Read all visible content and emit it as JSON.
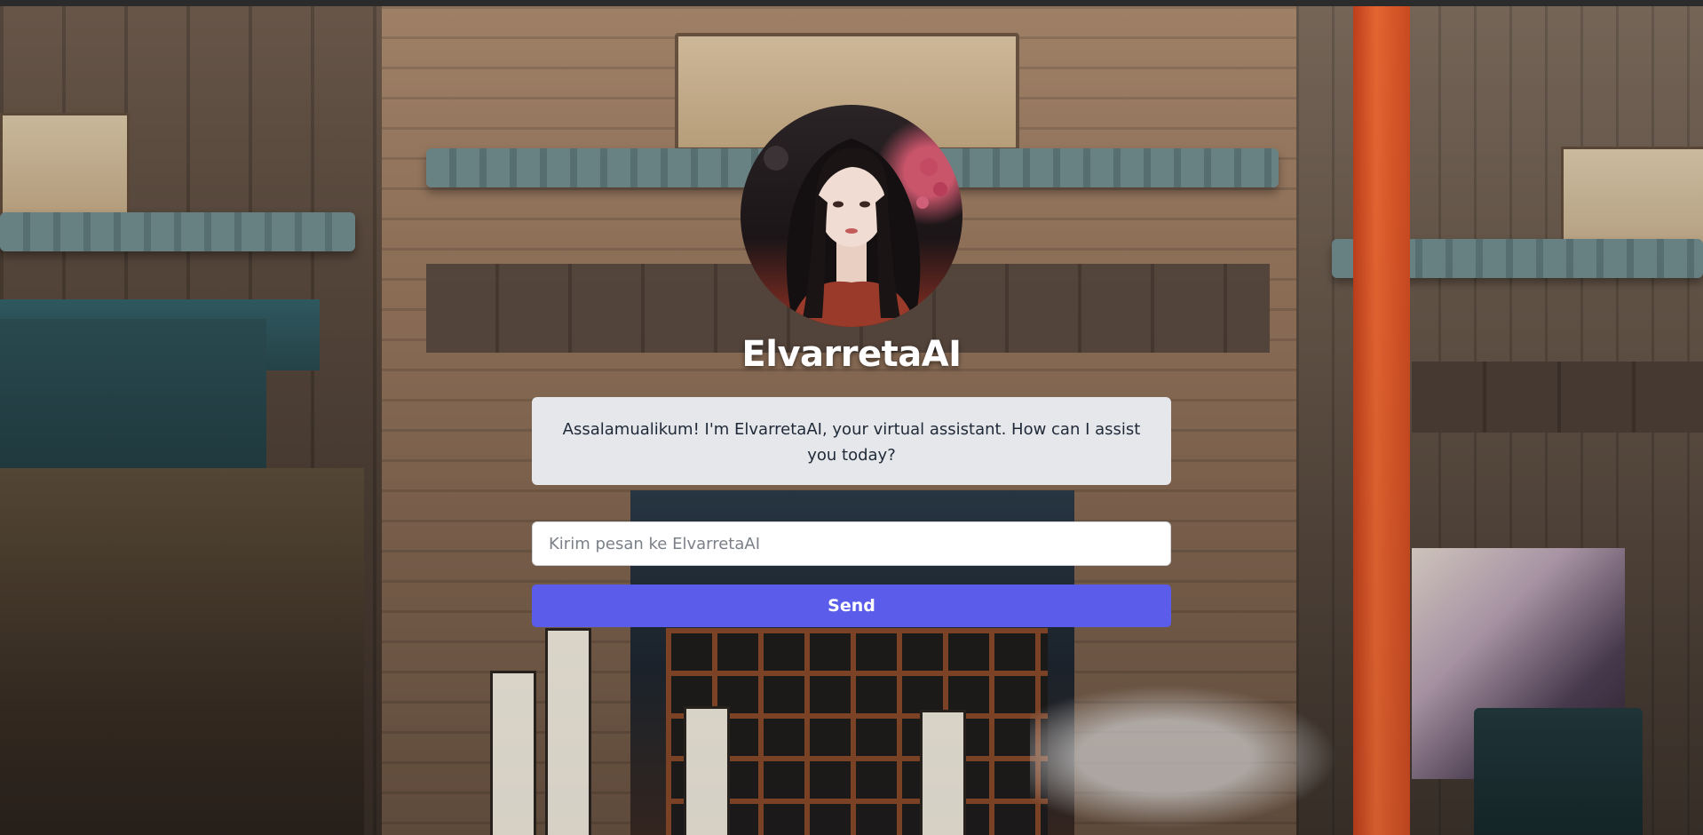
{
  "app": {
    "title": "ElvarretaAI"
  },
  "avatar": {
    "icon": "assistant-avatar"
  },
  "chat": {
    "messages": [
      {
        "role": "assistant",
        "text": "Assalamualikum! I'm ElvarretaAI, your virtual assistant. How can I assist you today?"
      }
    ]
  },
  "composer": {
    "value": "",
    "placeholder": "Kirim pesan ke ElvarretaAI",
    "send_label": "Send"
  },
  "colors": {
    "accent": "#5b5ce9",
    "bubble_bg": "#e5e7eb",
    "title_text": "#ffffff"
  }
}
